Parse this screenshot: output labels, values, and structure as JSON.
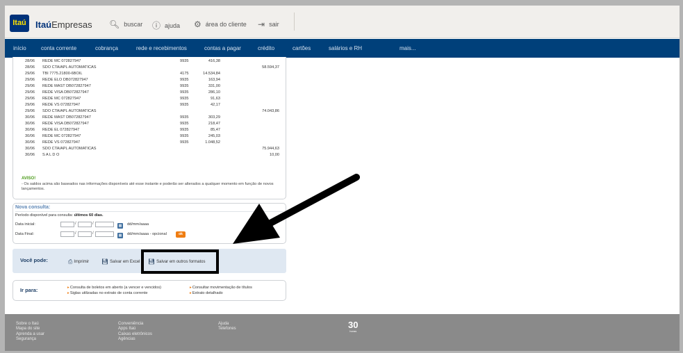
{
  "header": {
    "logo_text": "Itaú",
    "brand_prefix": "Itaú",
    "brand_suffix": "Empresas",
    "links": [
      {
        "label": "buscar",
        "icon": "search-icon"
      },
      {
        "label": "ajuda",
        "icon": "help-icon"
      },
      {
        "label": "área do cliente",
        "icon": "gear-icon"
      },
      {
        "label": "sair",
        "icon": "logout-icon"
      }
    ]
  },
  "nav": {
    "items": [
      "início",
      "conta corrente",
      "cobrança",
      "rede e recebimentos",
      "contas a pagar",
      "crédito",
      "cartões",
      "salários e RH",
      "mais..."
    ]
  },
  "statement": {
    "rows": [
      {
        "date": "28/06",
        "desc": "REDE MC 072827947",
        "agency": "9935",
        "value": "416,38",
        "balance": ""
      },
      {
        "date": "28/06",
        "desc": "SDO CTA/APL AUTOMATICAS",
        "agency": "",
        "value": "",
        "balance": "58.594,37"
      },
      {
        "date": "29/06",
        "desc": "TBI 7775.21800-6BOIL",
        "agency": "4175",
        "value": "14.534,84",
        "balance": ""
      },
      {
        "date": "29/06",
        "desc": "REDE ELO DB072827947",
        "agency": "9935",
        "value": "163,94",
        "balance": ""
      },
      {
        "date": "29/06",
        "desc": "REDE MAST DB072827947",
        "agency": "9935",
        "value": "331,00",
        "balance": ""
      },
      {
        "date": "29/06",
        "desc": "REDE VISA DB072827947",
        "agency": "9935",
        "value": "286,10",
        "balance": ""
      },
      {
        "date": "29/06",
        "desc": "REDE MC 072827947",
        "agency": "9935",
        "value": "91,63",
        "balance": ""
      },
      {
        "date": "29/06",
        "desc": "REDE VS 072827947",
        "agency": "9935",
        "value": "42,17",
        "balance": ""
      },
      {
        "date": "29/06",
        "desc": "SDO CTA/APL AUTOMATICAS",
        "agency": "",
        "value": "",
        "balance": "74.043,86"
      },
      {
        "date": "30/06",
        "desc": "REDE MAST DB072827947",
        "agency": "9935",
        "value": "303,29",
        "balance": ""
      },
      {
        "date": "30/06",
        "desc": "REDE VISA DB072827947",
        "agency": "9935",
        "value": "218,47",
        "balance": ""
      },
      {
        "date": "30/06",
        "desc": "REDE EL 072827947",
        "agency": "9935",
        "value": "85,47",
        "balance": ""
      },
      {
        "date": "30/06",
        "desc": "REDE MC 072827947",
        "agency": "9935",
        "value": "245,03",
        "balance": ""
      },
      {
        "date": "30/06",
        "desc": "REDE VS 072827947",
        "agency": "9935",
        "value": "1.048,52",
        "balance": ""
      },
      {
        "date": "30/06",
        "desc": "SDO CTA/APL AUTOMATICAS",
        "agency": "",
        "value": "",
        "balance": "75.944,63"
      },
      {
        "date": "30/06",
        "desc": "S A L D O",
        "agency": "",
        "value": "",
        "balance": "10,00"
      }
    ],
    "aviso_title": "AVISO!",
    "aviso_text": "- Os saldos acima são baseados nas informações disponíveis até esse instante e poderão ser alterados a qualquer momento em função de novos lançamentos."
  },
  "nova_consulta": {
    "title": "Nova consulta:",
    "period_label": "Período disponível para consulta:",
    "period_value": "últimos 60 dias.",
    "start_label": "Data inicial:",
    "end_label": "Data Final:",
    "format_hint": "dd/mm/aaaa",
    "format_hint_optional": "dd/mm/aaaa - opcional",
    "ok_label": "ok"
  },
  "voce_pode": {
    "title": "Você pode:",
    "actions": [
      {
        "label": "Imprimir",
        "icon": "printer-icon"
      },
      {
        "label": "Salvar em Excel",
        "icon": "save-icon"
      },
      {
        "label": "Salvar em outros formatos",
        "icon": "save-icon"
      }
    ]
  },
  "ir_para": {
    "title": "Ir para:",
    "links": [
      "Consulta de boletos em aberto (a vencer e vencidos)",
      "Siglas utilizadas no extrato de conta corrente",
      "Consultar movimentação de títulos",
      "Extrato detalhado"
    ]
  },
  "footer": {
    "col1": [
      "Sobre o Itaú",
      "Mapa do site",
      "Aprenda a usar",
      "Segurança"
    ],
    "col2": [
      "Conveniência",
      "Apps Itaú",
      "Caixas eletrônicos",
      "Agências"
    ],
    "col3": [
      "Ajuda",
      "Telefones"
    ],
    "badge_number": "30",
    "badge_text": "horas"
  },
  "colors": {
    "nav_bg": "#00407a",
    "logo_bg": "#00327a",
    "accent_orange": "#ef7d12",
    "aviso_green": "#4a9a18",
    "footer_bg": "#8a8a8a"
  }
}
